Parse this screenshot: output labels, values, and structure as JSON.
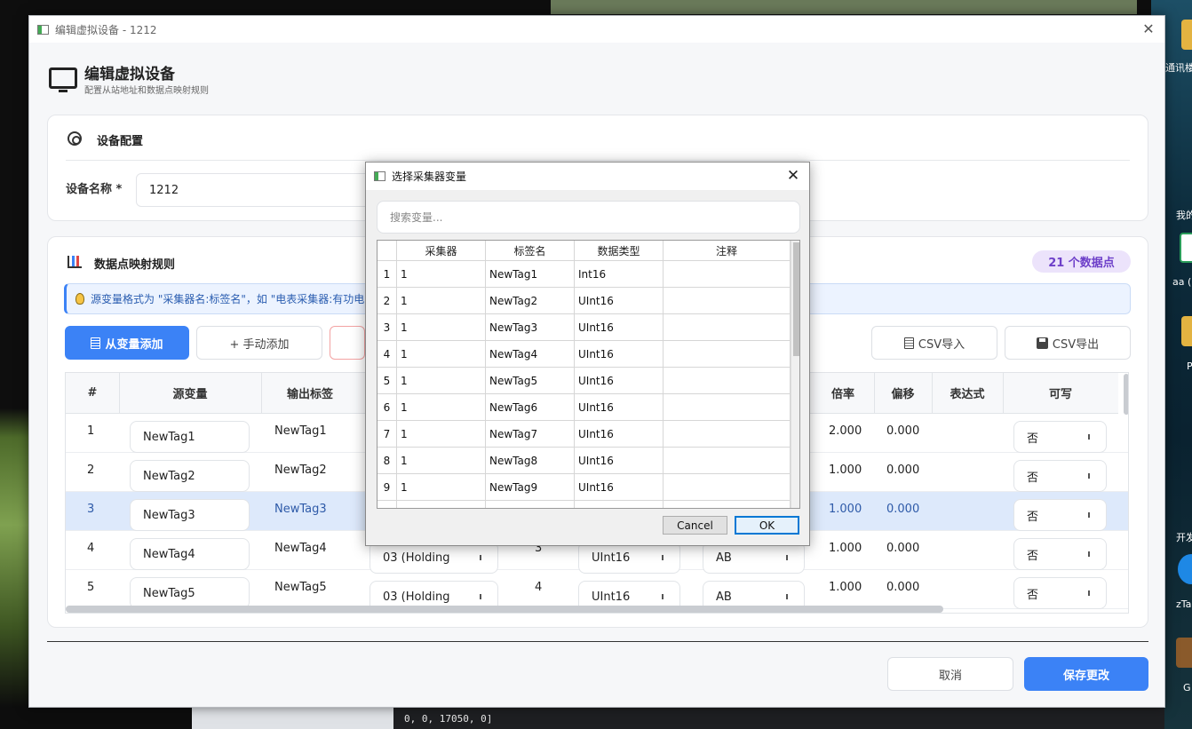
{
  "window": {
    "title": "编辑虚拟设备 - 1212"
  },
  "header": {
    "title": "编辑虚拟设备",
    "subtitle": "配置从站地址和数据点映射规则"
  },
  "device_config": {
    "section_title": "设备配置",
    "name_label": "设备名称",
    "required_mark": "*",
    "name_value": "1212"
  },
  "mapping": {
    "section_title": "数据点映射规则",
    "count_badge": "21 个数据点",
    "tip": "源变量格式为 \"采集器名:标签名\"，如 \"电表采集器:有功电",
    "add_from_var": "从变量添加",
    "manual_add": "+ 手动添加",
    "csv_import": "CSV导入",
    "csv_export": "CSV导出",
    "columns": [
      "#",
      "源变量",
      "输出标签",
      "倍率",
      "偏移",
      "表达式",
      "可写"
    ],
    "rows": [
      {
        "index": "1",
        "source": "NewTag1",
        "output": "NewTag1",
        "func": "",
        "addr": "",
        "dtype": "",
        "order": "",
        "scale": "2.000",
        "offset": "0.000",
        "writable": "否"
      },
      {
        "index": "2",
        "source": "NewTag2",
        "output": "NewTag2",
        "func": "",
        "addr": "",
        "dtype": "",
        "order": "",
        "scale": "1.000",
        "offset": "0.000",
        "writable": "否"
      },
      {
        "index": "3",
        "source": "NewTag3",
        "output": "NewTag3",
        "func": "",
        "addr": "",
        "dtype": "",
        "order": "",
        "scale": "1.000",
        "offset": "0.000",
        "writable": "否"
      },
      {
        "index": "4",
        "source": "NewTag4",
        "output": "NewTag4",
        "func": "03 (Holding",
        "addr": "3",
        "dtype": "UInt16",
        "order": "AB",
        "scale": "1.000",
        "offset": "0.000",
        "writable": "否"
      },
      {
        "index": "5",
        "source": "NewTag5",
        "output": "NewTag5",
        "func": "03 (Holding",
        "addr": "4",
        "dtype": "UInt16",
        "order": "AB",
        "scale": "1.000",
        "offset": "0.000",
        "writable": "否"
      }
    ]
  },
  "footer": {
    "cancel": "取消",
    "save": "保存更改"
  },
  "dialog": {
    "title": "选择采集器变量",
    "search_placeholder": "搜索变量...",
    "columns": [
      "采集器",
      "标签名",
      "数据类型",
      "注释"
    ],
    "rows": [
      {
        "n": "1",
        "collector": "1",
        "tag": "NewTag1",
        "type": "Int16",
        "note": ""
      },
      {
        "n": "2",
        "collector": "1",
        "tag": "NewTag2",
        "type": "UInt16",
        "note": ""
      },
      {
        "n": "3",
        "collector": "1",
        "tag": "NewTag3",
        "type": "UInt16",
        "note": ""
      },
      {
        "n": "4",
        "collector": "1",
        "tag": "NewTag4",
        "type": "UInt16",
        "note": ""
      },
      {
        "n": "5",
        "collector": "1",
        "tag": "NewTag5",
        "type": "UInt16",
        "note": ""
      },
      {
        "n": "6",
        "collector": "1",
        "tag": "NewTag6",
        "type": "UInt16",
        "note": ""
      },
      {
        "n": "7",
        "collector": "1",
        "tag": "NewTag7",
        "type": "UInt16",
        "note": ""
      },
      {
        "n": "8",
        "collector": "1",
        "tag": "NewTag8",
        "type": "UInt16",
        "note": ""
      },
      {
        "n": "9",
        "collector": "1",
        "tag": "NewTag9",
        "type": "UInt16",
        "note": ""
      }
    ],
    "cancel": "Cancel",
    "ok": "OK"
  },
  "desktop": {
    "labels": [
      "通讯楼",
      "我的",
      "aa (",
      "开发",
      "zTa",
      "G",
      "P"
    ],
    "terminal_text": "0, 0, 17050, 0]"
  }
}
